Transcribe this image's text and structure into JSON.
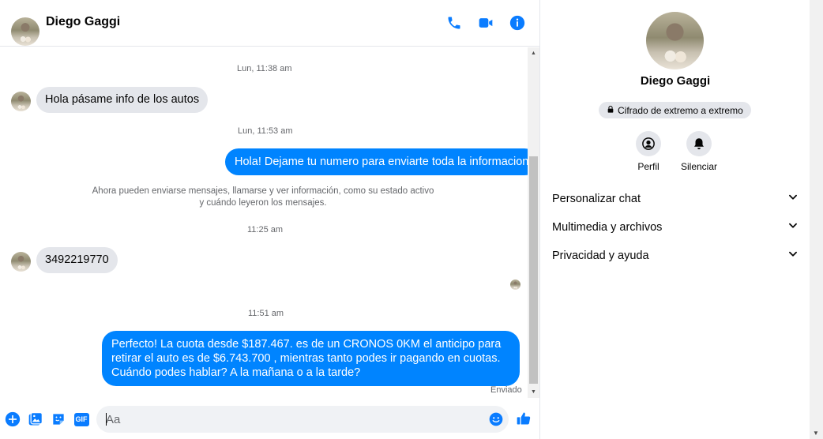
{
  "header": {
    "contact_name": "Diego Gaggi",
    "icons": [
      "phone-icon",
      "video-icon",
      "info-icon"
    ]
  },
  "messages": {
    "timestamps": [
      "Lun, 11:38 am",
      "Lun, 11:53 am",
      "11:25 am",
      "11:51 am"
    ],
    "msg1": "Hola pásame info de los autos",
    "msg2": "Hola! Dejame tu numero  para enviarte toda la informacion",
    "system_line1": "Ahora pueden enviarse mensajes, llamarse y ver información, como su estado activo",
    "system_line2": "y cuándo leyeron los mensajes.",
    "msg3": "3492219770",
    "msg4": "Perfecto! La cuota desde $187.467. es de un CRONOS 0KM el anticipo para retirar el auto es de $6.743.700 , mientras tanto podes ir pagando en cuotas. Cuándo podes hablar? A la mañana o a la tarde?",
    "status": "Enviado"
  },
  "composer": {
    "placeholder": "Aa",
    "icons": [
      "plus-icon",
      "photo-icon",
      "sticker-icon",
      "gif-icon",
      "emoji-icon",
      "like-icon"
    ],
    "gif_label": "GIF"
  },
  "panel": {
    "name": "Diego Gaggi",
    "encryption": "Cifrado de extremo a extremo",
    "actions": [
      {
        "label": "Perfil",
        "icon": "profile-icon"
      },
      {
        "label": "Silenciar",
        "icon": "bell-icon"
      }
    ],
    "sections": [
      "Personalizar chat",
      "Multimedia y archivos",
      "Privacidad y ayuda"
    ]
  },
  "colors": {
    "accent": "#0084ff",
    "bubble_in": "#e4e6eb",
    "text_secondary": "#65676b"
  }
}
